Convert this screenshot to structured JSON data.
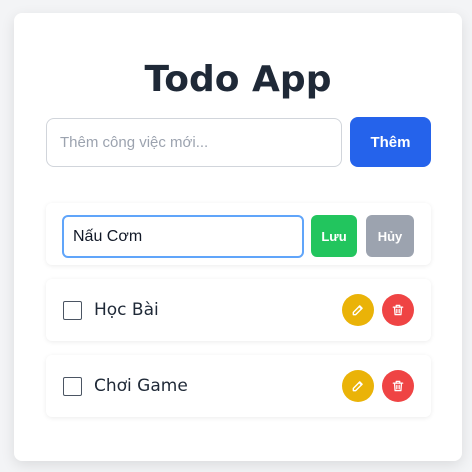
{
  "app": {
    "title": "Todo App"
  },
  "add_form": {
    "placeholder": "Thêm công việc mới...",
    "button_label": "Thêm"
  },
  "editing": {
    "value": "Nấu Cơm",
    "save_label": "Lưu",
    "cancel_label": "Hủy"
  },
  "todos": [
    {
      "text": "Học Bài",
      "checked": false
    },
    {
      "text": "Chơi Game",
      "checked": false
    }
  ],
  "colors": {
    "primary": "#2563eb",
    "save": "#22c55e",
    "cancel": "#9ca3af",
    "edit": "#eab308",
    "delete": "#ef4444"
  },
  "icons": {
    "edit": "pencil-icon",
    "delete": "trash-icon"
  }
}
